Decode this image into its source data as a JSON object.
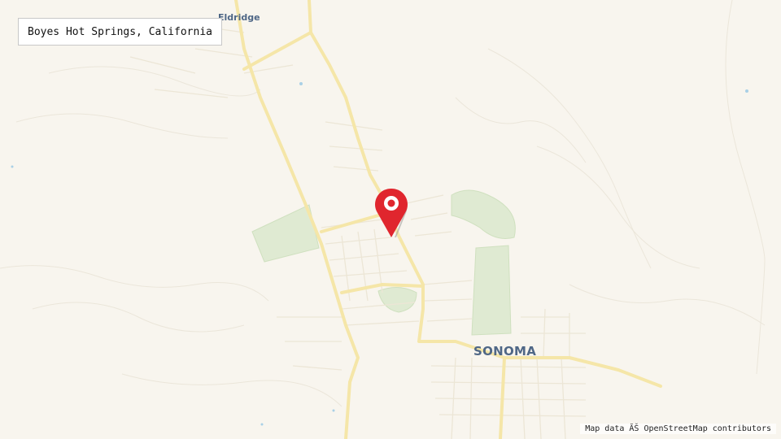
{
  "location_search": {
    "value": "Boyes Hot Springs, California"
  },
  "places": {
    "eldridge": "Eldridge",
    "sonoma": "SONOMA"
  },
  "attribution": "Map data ĂŠ OpenStreetMap contributors",
  "marker": {
    "color": "#e0262e",
    "icon": "map-pin-icon"
  },
  "colors": {
    "land": "#f8f5ee",
    "major_road": "#f7e9a8",
    "minor_road": "#ece6d6",
    "park": "#d6e8c8",
    "label": "#4f6786"
  }
}
